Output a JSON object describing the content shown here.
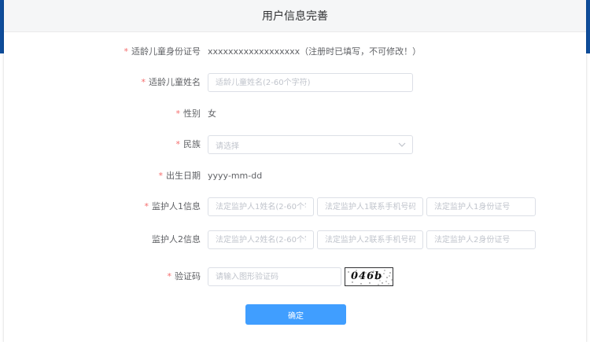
{
  "dialog": {
    "title": "用户信息完善"
  },
  "form": {
    "id_number": {
      "label": "适龄儿童身份证号",
      "value": "xxxxxxxxxxxxxxxxxx（注册时已填写，不可修改！）"
    },
    "child_name": {
      "label": "适龄儿童姓名",
      "placeholder": "适龄儿童姓名(2-60个字符)"
    },
    "gender": {
      "label": "性别",
      "value": "女"
    },
    "ethnicity": {
      "label": "民族",
      "placeholder": "请选择"
    },
    "birth_date": {
      "label": "出生日期",
      "value": "yyyy-mm-dd"
    },
    "guardian1": {
      "label": "监护人1信息",
      "name_placeholder": "法定监护人1姓名(2-60个字符",
      "phone_placeholder": "法定监护人1联系手机号码",
      "id_placeholder": "法定监护人1身份证号"
    },
    "guardian2": {
      "label": "监护人2信息",
      "name_placeholder": "法定监护人2姓名(2-60个字符",
      "phone_placeholder": "法定监护人2联系手机号码",
      "id_placeholder": "法定监护人2身份证号"
    },
    "captcha": {
      "label": "验证码",
      "placeholder": "请输入图形验证码",
      "image_text": "046b"
    },
    "required_mark": "*"
  },
  "submit": {
    "label": "确定"
  },
  "colors": {
    "primary": "#409eff",
    "required": "#f56c6c",
    "header_bg": "#f5f6f7",
    "side_bar": "#0e4d9c"
  },
  "icons": {
    "select_arrow": "chevron-down-icon"
  }
}
